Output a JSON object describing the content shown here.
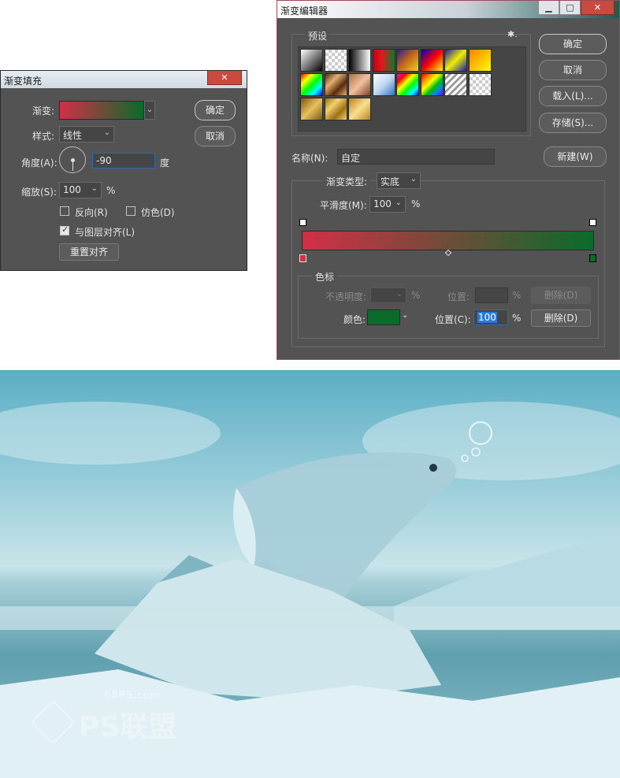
{
  "gradient_fill": {
    "title": "渐变填充",
    "close_glyph": "✕",
    "gradient_label": "渐变:",
    "style_label": "样式:",
    "style_value": "线性",
    "angle_label": "角度(A):",
    "angle_value": "-90",
    "angle_unit": "度",
    "scale_label": "缩放(S):",
    "scale_value": "100",
    "scale_unit": "%",
    "reverse_label": "反向(R)",
    "reverse_checked": false,
    "dither_label": "仿色(D)",
    "dither_checked": false,
    "align_label": "与图层对齐(L)",
    "align_checked": true,
    "reset_align_label": "重置对齐",
    "ok_label": "确定",
    "cancel_label": "取消",
    "gradient_start_color": "#d42e48",
    "gradient_end_color": "#0a6b2a"
  },
  "gradient_editor": {
    "title": "渐变编辑器",
    "caption_buttons": [
      "▁",
      "□",
      "✕"
    ],
    "presets_label": "预设",
    "gear_glyph": "✱.",
    "presets": [
      "linear-gradient(135deg,#fff,#000)",
      "repeating-conic-gradient(#ccc 0 25%,#fff 0 50%) 0 0/8px 8px",
      "linear-gradient(90deg,#000,#fff)",
      "linear-gradient(90deg,#c8001b,#e01a1a 40%,#0b7a2a)",
      "linear-gradient(135deg,#2b1a8a,#c66a1a,#f0d020)",
      "linear-gradient(135deg,#0000c0,#ff0000,#ffff00)",
      "linear-gradient(135deg,#1a1ab0,#f0f000,#1a1ab0)",
      "linear-gradient(135deg,#ff8000,#ffff00)",
      "linear-gradient(135deg,#ff0000,#ffff00,#00ff00,#00ffff,#0000ff)",
      "linear-gradient(135deg,#5a2a0a,#e0b070,#5a2a0a,#e0b070)",
      "linear-gradient(135deg,#b07040,#f0c0a0,#804020)",
      "linear-gradient(135deg,#fff,#c0d8f0,#3070c0)",
      "linear-gradient(135deg,#ff00ff,#ff0000,#ffff00,#00ff00,#00ffff,#0000ff)",
      "linear-gradient(135deg,#ff0000,#ff8000,#ffff00,#00c000,#0080ff,#8000ff)",
      "repeating-linear-gradient(135deg,#fff 0 3px,#999 3px 6px)",
      "repeating-conic-gradient(#ccc 0 25%,#fff 0 50%) 0 0/8px 8px",
      "linear-gradient(135deg,#7a5a10,#e8c060,#7a5a10)",
      "linear-gradient(135deg,#a07010,#f0d070,#a07010,#f0d070)",
      "linear-gradient(135deg,#c08020,#f8e090,#c08020)"
    ],
    "name_label": "名称(N):",
    "name_value": "自定",
    "new_label": "新建(W)",
    "type_label": "渐变类型:",
    "type_value": "实底",
    "smooth_label": "平滑度(M):",
    "smooth_value": "100",
    "smooth_unit": "%",
    "stops_label": "色标",
    "opacity_label": "不透明度:",
    "opacity_unit": "%",
    "opacity_position_label": "位置:",
    "opacity_position_unit": "%",
    "opacity_delete_label": "删除(D)",
    "color_label": "颜色:",
    "color_value": "#0a6b2a",
    "color_position_label": "位置(C):",
    "color_position_value": "100",
    "color_position_unit": "%",
    "color_delete_label": "删除(D)",
    "ok_label": "确定",
    "cancel_label": "取消",
    "load_label": "载入(L)...",
    "save_label": "存储(S)...",
    "start_color": "#d42e48",
    "end_color": "#0a6b2a"
  },
  "artwork": {
    "watermark_url": "68PS.com",
    "watermark_brand": "PS联盟"
  }
}
